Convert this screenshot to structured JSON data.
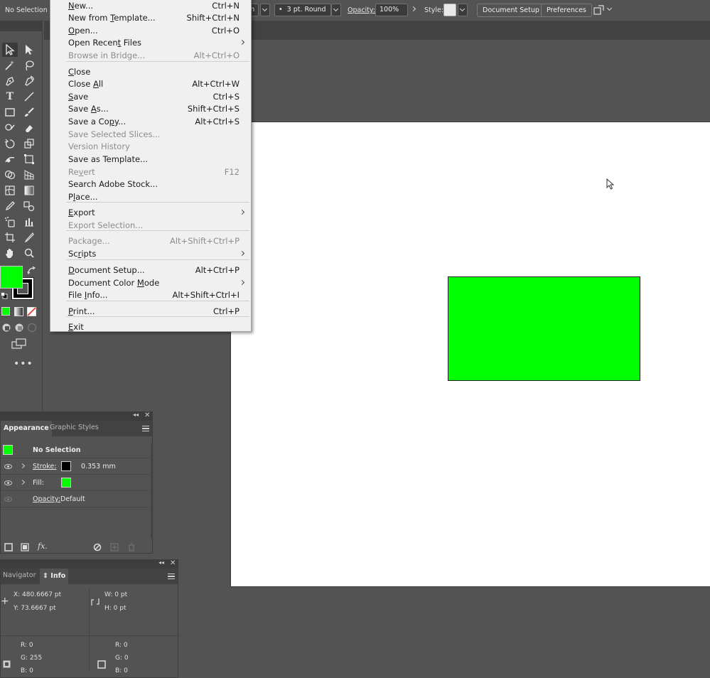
{
  "control_bar": {
    "selection_label": "No Selection",
    "stroke_profile_fragment": "m",
    "brush_value": "3 pt. Round",
    "opacity_label": "Opacity:",
    "opacity_value": "100%",
    "style_label": "Style:",
    "document_setup_btn": "Document Setup",
    "preferences_btn": "Preferences"
  },
  "file_menu": {
    "items": [
      {
        "label": "New...",
        "shortcut": "Ctrl+N",
        "enabled": true
      },
      {
        "label": "New from Template...",
        "shortcut": "Shift+Ctrl+N",
        "enabled": true
      },
      {
        "label": "Open...",
        "shortcut": "Ctrl+O",
        "enabled": true
      },
      {
        "label": "Open Recent Files",
        "shortcut": "",
        "enabled": true,
        "submenu": true
      },
      {
        "label": "Browse in Bridge...",
        "shortcut": "Alt+Ctrl+O",
        "enabled": false
      },
      {
        "label": "Close",
        "shortcut": "",
        "enabled": true
      },
      {
        "label": "Close All",
        "shortcut": "Alt+Ctrl+W",
        "enabled": true
      },
      {
        "label": "Save",
        "shortcut": "Ctrl+S",
        "enabled": true
      },
      {
        "label": "Save As...",
        "shortcut": "Shift+Ctrl+S",
        "enabled": true
      },
      {
        "label": "Save a Copy...",
        "shortcut": "Alt+Ctrl+S",
        "enabled": true
      },
      {
        "label": "Save Selected Slices...",
        "shortcut": "",
        "enabled": false
      },
      {
        "label": "Version History",
        "shortcut": "",
        "enabled": false
      },
      {
        "label": "Save as Template...",
        "shortcut": "",
        "enabled": true
      },
      {
        "label": "Revert",
        "shortcut": "F12",
        "enabled": false
      },
      {
        "label": "Search Adobe Stock...",
        "shortcut": "",
        "enabled": true
      },
      {
        "label": "Place...",
        "shortcut": "",
        "enabled": true
      },
      {
        "label": "Export",
        "shortcut": "",
        "enabled": true,
        "submenu": true
      },
      {
        "label": "Export Selection...",
        "shortcut": "",
        "enabled": false
      },
      {
        "label": "Package...",
        "shortcut": "Alt+Shift+Ctrl+P",
        "enabled": false
      },
      {
        "label": "Scripts",
        "shortcut": "",
        "enabled": true,
        "submenu": true
      },
      {
        "label": "Document Setup...",
        "shortcut": "Alt+Ctrl+P",
        "enabled": true
      },
      {
        "label": "Document Color Mode",
        "shortcut": "",
        "enabled": true,
        "submenu": true
      },
      {
        "label": "File Info...",
        "shortcut": "Alt+Shift+Ctrl+I",
        "enabled": true
      },
      {
        "label": "Print...",
        "shortcut": "Ctrl+P",
        "enabled": true
      },
      {
        "label": "Exit",
        "shortcut": "",
        "enabled": true
      }
    ]
  },
  "appearance_panel": {
    "tab_active": "Appearance",
    "tab_inactive": "Graphic Styles",
    "header": "No Selection",
    "stroke_label": "Stroke:",
    "stroke_value": "0.353 mm",
    "fill_label": "Fill:",
    "opacity_label": "Opacity:",
    "opacity_value": "Default",
    "fx_label": "fx."
  },
  "info_panel": {
    "tab_inactive": "Navigator",
    "tab_active": "Info",
    "x": "X:  480.6667 pt",
    "y": "Y:  73.6667 pt",
    "w": "W:  0 pt",
    "h": "H:  0 pt",
    "left_r": "R:  0",
    "left_g": "G:  255",
    "left_b": "B:  0",
    "right_r": "R:  0",
    "right_g": "G:  0",
    "right_b": "B:  0"
  },
  "colors": {
    "fill": "#00ff00",
    "stroke": "#000000",
    "ui_bg": "#535353",
    "menu_bg": "#f0f0f0"
  }
}
